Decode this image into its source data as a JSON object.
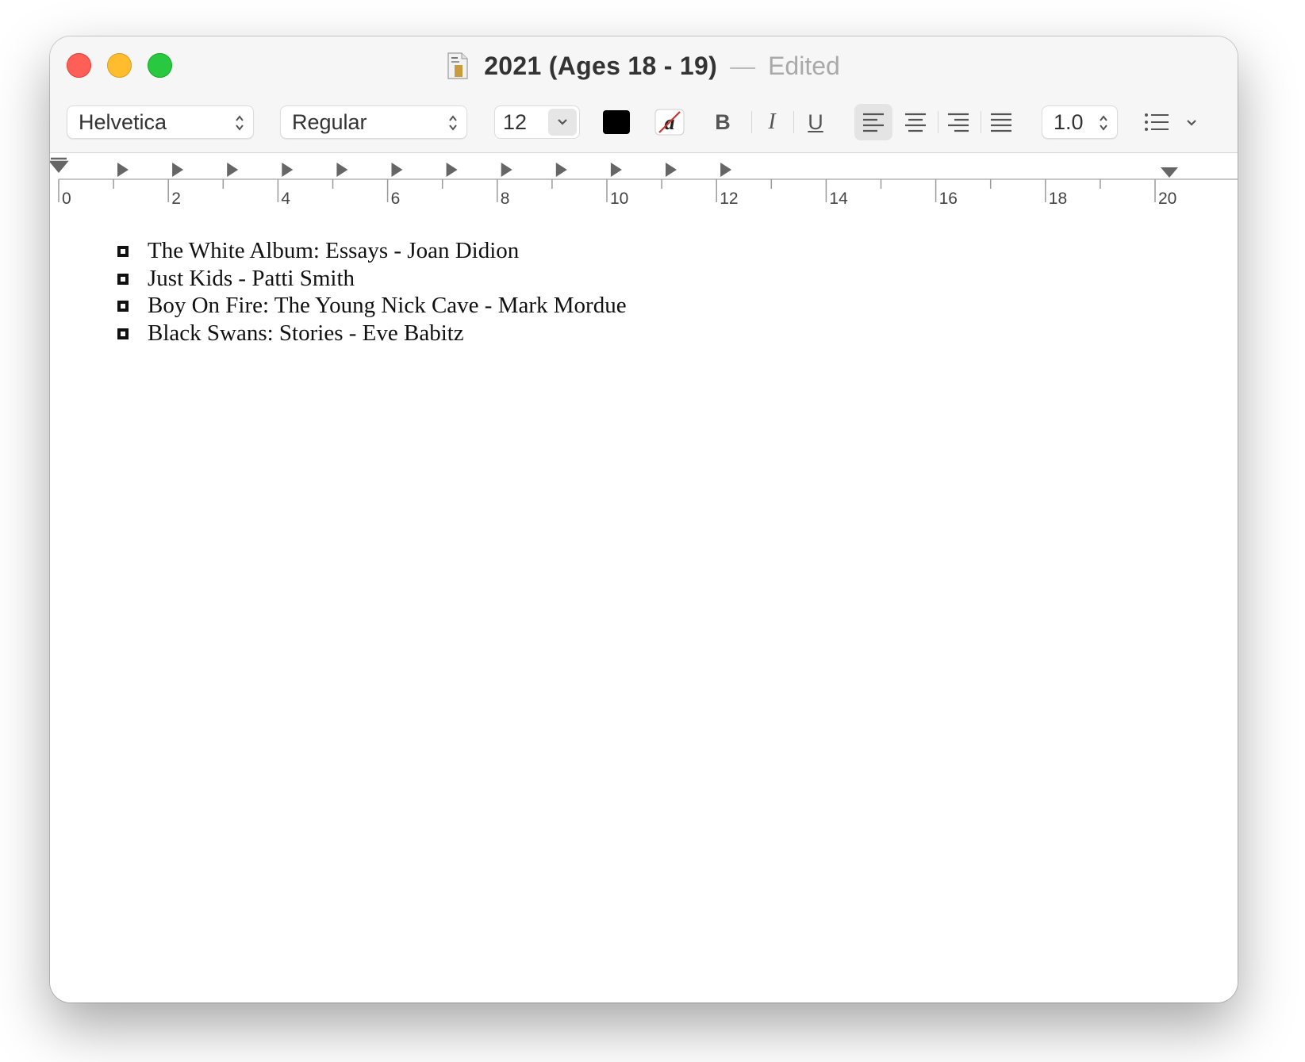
{
  "window": {
    "title": "2021 (Ages 18 - 19)",
    "title_separator": "—",
    "status": "Edited"
  },
  "toolbar": {
    "font_family": "Helvetica",
    "font_style": "Regular",
    "font_size": "12",
    "text_color": "#000000",
    "bold_label": "B",
    "italic_label": "I",
    "underline_label": "U",
    "line_spacing": "1.0"
  },
  "ruler": {
    "labels": [
      "0",
      "2",
      "4",
      "6",
      "8",
      "10",
      "12",
      "14",
      "16",
      "18",
      "20"
    ]
  },
  "document": {
    "items": [
      "The White Album: Essays - Joan Didion",
      "Just Kids - Patti Smith",
      "Boy On Fire: The Young Nick Cave - Mark Mordue",
      "Black Swans: Stories - Eve Babitz"
    ]
  }
}
